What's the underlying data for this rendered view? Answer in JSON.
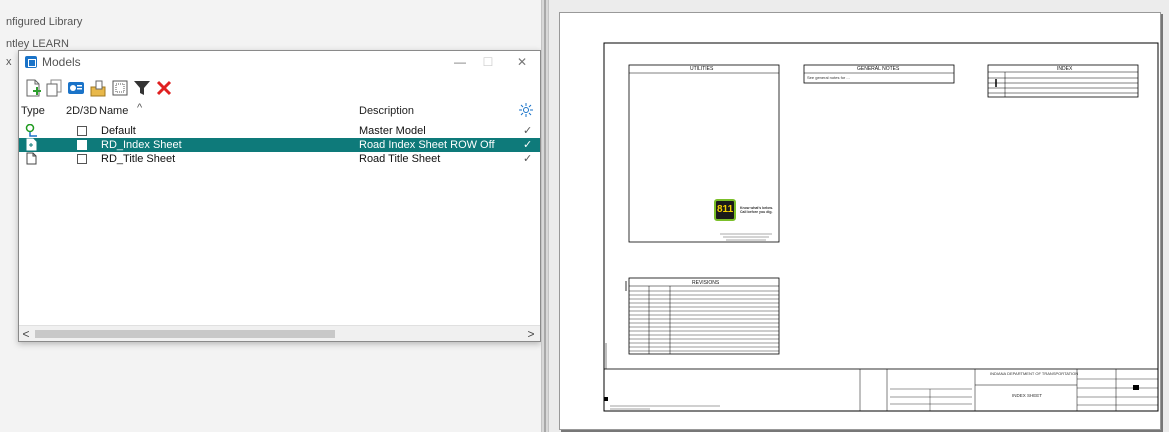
{
  "explorer": {
    "items": [
      "nfigured Library",
      "ntley LEARN",
      "x"
    ]
  },
  "dialog": {
    "title": "Models",
    "minimize": "—",
    "maximize": "☐",
    "close": "✕",
    "columns": {
      "type": "Type",
      "dim": "2D/3D",
      "name": "Name",
      "sort_indicator": "^",
      "description": "Description"
    },
    "rows": [
      {
        "name": "Default",
        "description": "Master Model",
        "icon": "design-model-icon",
        "selected": false
      },
      {
        "name": "RD_Index Sheet",
        "description": "Road Index Sheet ROW Off",
        "icon": "sheet-model-icon",
        "selected": true
      },
      {
        "name": "RD_Title Sheet",
        "description": "Road Title Sheet",
        "icon": "sheet-model-icon",
        "selected": false
      }
    ],
    "check": "✓",
    "scroll_left": "<",
    "scroll_right": ">"
  },
  "drawing": {
    "utilities": "UTILITIES",
    "general_notes": "GENERAL NOTES",
    "general_notes_body": "See general notes for ...",
    "index": "INDEX",
    "revisions": "REVISIONS",
    "logo_number": "811",
    "logo_tagline": "Know what's below. Call before you dig.",
    "title_block_org": "INDIANA DEPARTMENT OF TRANSPORTATION",
    "title_block_sheet": "INDEX SHEET"
  },
  "colors": {
    "selected_row": "#0e7a7a",
    "accent_blue": "#1a73c8",
    "delete_red": "#e02020"
  }
}
